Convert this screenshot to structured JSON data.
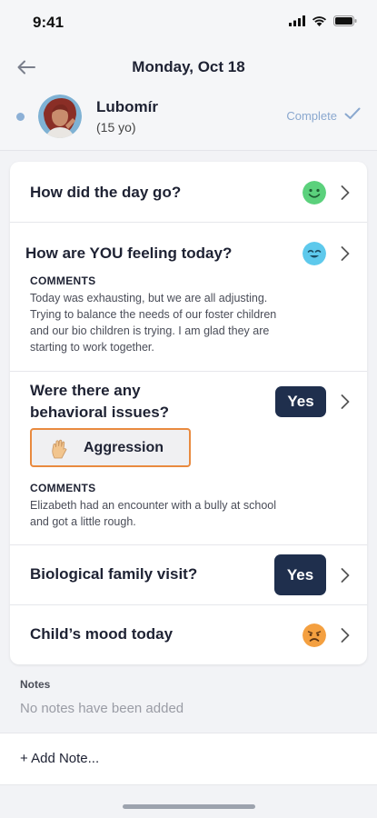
{
  "status_bar": {
    "time": "9:41"
  },
  "header": {
    "title": "Monday, Oct 18"
  },
  "child": {
    "name": "Lubomír",
    "age": "(15 yo)",
    "status": "Complete"
  },
  "questions": [
    {
      "text": "How did the day go?",
      "mood_icon": "happy-face-icon",
      "mood_color": "#5BD17C"
    },
    {
      "text": "How are YOU feeling today?",
      "mood_icon": "content-face-icon",
      "mood_color": "#5EC9EC",
      "comments_label": "COMMENTS",
      "comments_lines": [
        "Today was exhausting, but we are all adjusting.",
        "Trying to balance the needs of our foster children",
        "and our bio children is trying. I am glad they are",
        "starting to work together."
      ]
    },
    {
      "text_lines": [
        "Were there any",
        "behavioral issues?"
      ],
      "answer": "Yes",
      "tag": {
        "icon": "raised-hand-icon",
        "label": "Aggression",
        "border_color": "#E98A3F"
      },
      "comments_label": "COMMENTS",
      "comments_lines": [
        "Elizabeth had an encounter with a bully at school",
        "and got a little rough."
      ]
    },
    {
      "text": "Biological family visit?",
      "answer": "Yes"
    },
    {
      "text": "Child’s mood today",
      "mood_icon": "sad-face-icon",
      "mood_color": "#F4A040"
    }
  ],
  "notes": {
    "label": "Notes",
    "empty_text": "No notes have been added",
    "add_label": "+ Add Note..."
  },
  "colors": {
    "accent_navy": "#1F2F4D",
    "complete_blue": "#8AA8CF"
  }
}
